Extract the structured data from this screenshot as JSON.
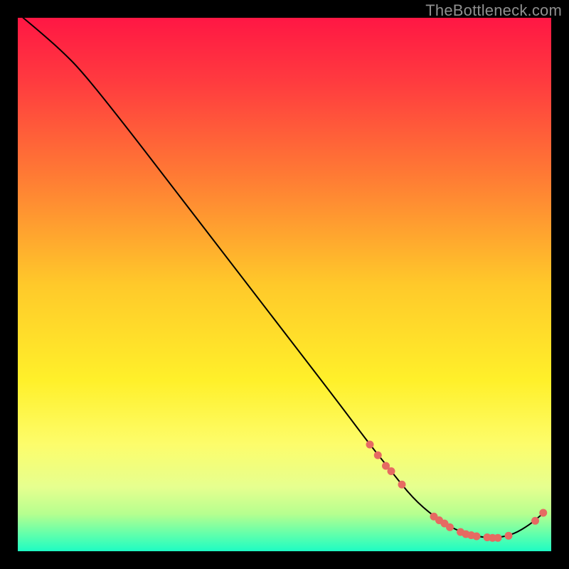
{
  "watermark": "TheBottleneck.com",
  "chart_data": {
    "type": "line",
    "title": "",
    "xlabel": "",
    "ylabel": "",
    "xlim": [
      0,
      100
    ],
    "ylim": [
      0,
      100
    ],
    "grid": false,
    "legend": false,
    "gradient_stops": [
      {
        "pct": 0,
        "color": "#ff1744"
      },
      {
        "pct": 12,
        "color": "#ff3b3f"
      },
      {
        "pct": 30,
        "color": "#ff7c34"
      },
      {
        "pct": 50,
        "color": "#ffc92a"
      },
      {
        "pct": 68,
        "color": "#fff02a"
      },
      {
        "pct": 80,
        "color": "#fdfd6b"
      },
      {
        "pct": 88,
        "color": "#e6ff8f"
      },
      {
        "pct": 93,
        "color": "#b6ff8f"
      },
      {
        "pct": 97,
        "color": "#5dffad"
      },
      {
        "pct": 100,
        "color": "#1efcc3"
      }
    ],
    "series": [
      {
        "name": "curve",
        "color": "#000000",
        "stroke_width": 2,
        "points": [
          {
            "x": 1,
            "y": 100
          },
          {
            "x": 4,
            "y": 97.5
          },
          {
            "x": 8,
            "y": 94
          },
          {
            "x": 12,
            "y": 90
          },
          {
            "x": 20,
            "y": 80
          },
          {
            "x": 30,
            "y": 67
          },
          {
            "x": 40,
            "y": 54
          },
          {
            "x": 50,
            "y": 41
          },
          {
            "x": 60,
            "y": 28
          },
          {
            "x": 66,
            "y": 20
          },
          {
            "x": 70,
            "y": 15
          },
          {
            "x": 74,
            "y": 10
          },
          {
            "x": 78,
            "y": 6.5
          },
          {
            "x": 82,
            "y": 4
          },
          {
            "x": 86,
            "y": 2.7
          },
          {
            "x": 90,
            "y": 2.5
          },
          {
            "x": 93,
            "y": 3.2
          },
          {
            "x": 96,
            "y": 5
          },
          {
            "x": 98,
            "y": 6.7
          },
          {
            "x": 99,
            "y": 7.5
          }
        ]
      },
      {
        "name": "markers",
        "color": "#e66a62",
        "marker_radius": 5.5,
        "points": [
          {
            "x": 66,
            "y": 20
          },
          {
            "x": 67.5,
            "y": 18
          },
          {
            "x": 69,
            "y": 16
          },
          {
            "x": 70,
            "y": 15
          },
          {
            "x": 72,
            "y": 12.5
          },
          {
            "x": 78,
            "y": 6.5
          },
          {
            "x": 79,
            "y": 5.8
          },
          {
            "x": 80,
            "y": 5.2
          },
          {
            "x": 81,
            "y": 4.5
          },
          {
            "x": 83,
            "y": 3.6
          },
          {
            "x": 84,
            "y": 3.2
          },
          {
            "x": 85,
            "y": 3.0
          },
          {
            "x": 86,
            "y": 2.8
          },
          {
            "x": 88,
            "y": 2.6
          },
          {
            "x": 89,
            "y": 2.5
          },
          {
            "x": 90,
            "y": 2.5
          },
          {
            "x": 92,
            "y": 2.9
          },
          {
            "x": 97,
            "y": 5.7
          },
          {
            "x": 98.5,
            "y": 7.2
          }
        ]
      }
    ]
  }
}
